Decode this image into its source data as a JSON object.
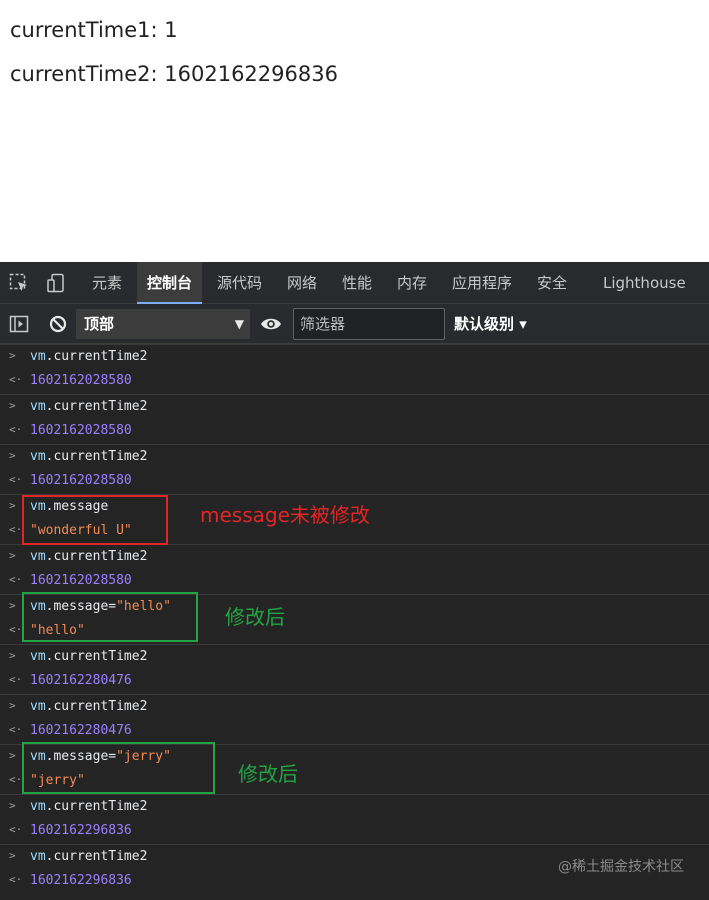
{
  "page": {
    "line1": "currentTime1: 1",
    "line2": "currentTime2: 1602162296836"
  },
  "devtools": {
    "tabs": [
      "元素",
      "控制台",
      "源代码",
      "网络",
      "性能",
      "内存",
      "应用程序",
      "安全",
      "Lighthouse"
    ],
    "active_tab": "控制台",
    "context": "顶部",
    "filter_placeholder": "筛选器",
    "levels": "默认级别 ▾"
  },
  "console": [
    {
      "in": "vm.currentTime2",
      "out": "1602162028580",
      "out_type": "number"
    },
    {
      "in": "vm.currentTime2",
      "out": "1602162028580",
      "out_type": "number"
    },
    {
      "in": "vm.currentTime2",
      "out": "1602162028580",
      "out_type": "number"
    },
    {
      "in": "vm.message",
      "out": "\"wonderful U\"",
      "out_type": "string"
    },
    {
      "in": "vm.currentTime2",
      "out": "1602162028580",
      "out_type": "number"
    },
    {
      "in": "vm.message=\"hello\"",
      "out": "\"hello\"",
      "out_type": "string"
    },
    {
      "in": "vm.currentTime2",
      "out": "1602162280476",
      "out_type": "number"
    },
    {
      "in": "vm.currentTime2",
      "out": "1602162280476",
      "out_type": "number"
    },
    {
      "in": "vm.message=\"jerry\"",
      "out": "\"jerry\"",
      "out_type": "string"
    },
    {
      "in": "vm.currentTime2",
      "out": "1602162296836",
      "out_type": "number"
    },
    {
      "in": "vm.currentTime2",
      "out": "1602162296836",
      "out_type": "number"
    }
  ],
  "annotations": {
    "red_note": "message未被修改",
    "green_note_1": "修改后",
    "green_note_2": "修改后"
  },
  "watermark": "@稀土掘金技术社区",
  "colors": {
    "red": "#e22525",
    "green": "#21a542",
    "number": "#9980ff",
    "string": "#f28b54"
  }
}
